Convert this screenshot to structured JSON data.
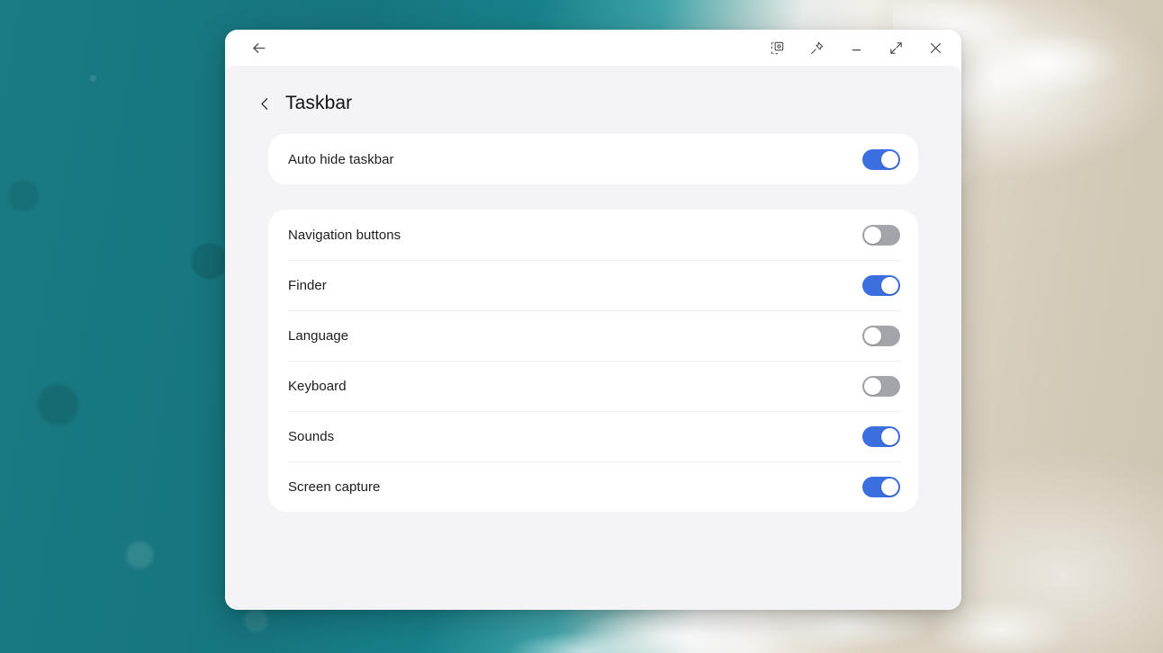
{
  "window": {
    "titlebar": {
      "back_icon": "arrow-left-icon",
      "controls": [
        {
          "name": "screen-snip-icon",
          "label": "Screen snip"
        },
        {
          "name": "pin-icon",
          "label": "Pin window"
        },
        {
          "name": "minimize-icon",
          "label": "Minimize"
        },
        {
          "name": "maximize-icon",
          "label": "Maximize"
        },
        {
          "name": "close-icon",
          "label": "Close"
        }
      ]
    },
    "header": {
      "back_icon": "chevron-left-icon",
      "title": "Taskbar"
    },
    "cards": [
      {
        "id": "auto-hide-card",
        "rows": [
          {
            "id": "auto-hide-taskbar",
            "label": "Auto hide taskbar",
            "toggle": "on"
          }
        ]
      },
      {
        "id": "taskbar-items-card",
        "rows": [
          {
            "id": "navigation-buttons",
            "label": "Navigation buttons",
            "toggle": "off"
          },
          {
            "id": "finder",
            "label": "Finder",
            "toggle": "on"
          },
          {
            "id": "language",
            "label": "Language",
            "toggle": "off"
          },
          {
            "id": "keyboard",
            "label": "Keyboard",
            "toggle": "off"
          },
          {
            "id": "sounds",
            "label": "Sounds",
            "toggle": "on"
          },
          {
            "id": "screen-capture",
            "label": "Screen capture",
            "toggle": "on"
          }
        ]
      }
    ]
  },
  "colors": {
    "toggle_on": "#3b6fe0",
    "toggle_off": "#a4a4ab",
    "card_bg": "#ffffff",
    "page_bg": "#f4f4f6",
    "text": "#1d1d1f"
  }
}
